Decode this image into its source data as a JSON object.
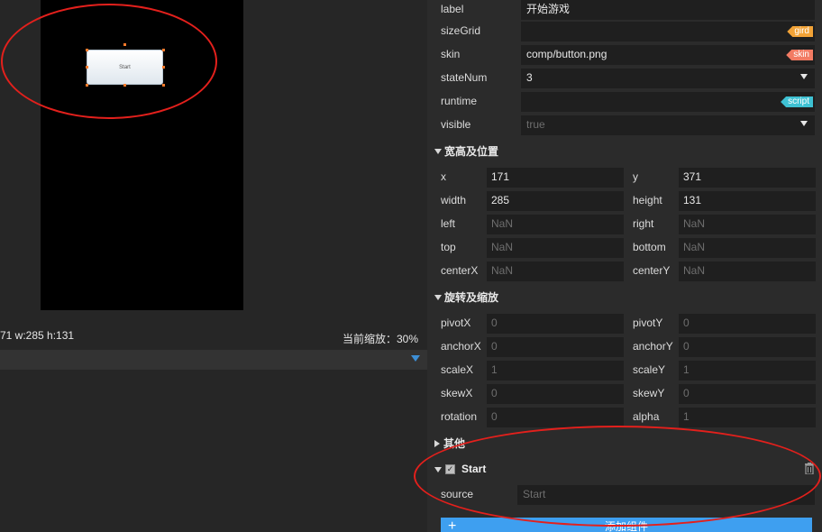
{
  "stage": {
    "selected_button_text": "Start"
  },
  "status": {
    "selection_info": "71  w:285 h:131",
    "zoom": "当前缩放：30%"
  },
  "properties": [
    {
      "label": "label",
      "value": "开始游戏",
      "muted": false,
      "tag": null,
      "dropdown": false
    },
    {
      "label": "sizeGrid",
      "value": "",
      "muted": false,
      "tag": "gird",
      "dropdown": false
    },
    {
      "label": "skin",
      "value": "comp/button.png",
      "muted": false,
      "tag": "skin",
      "dropdown": false
    },
    {
      "label": "stateNum",
      "value": "3",
      "muted": false,
      "tag": null,
      "dropdown": true
    },
    {
      "label": "runtime",
      "value": "",
      "muted": false,
      "tag": "script",
      "dropdown": false
    },
    {
      "label": "visible",
      "value": "true",
      "muted": true,
      "tag": null,
      "dropdown": true
    }
  ],
  "sections": {
    "size_position": "宽高及位置",
    "rotate_scale": "旋转及缩放",
    "other": "其他"
  },
  "size_position": [
    {
      "l_label": "x",
      "l_value": "171",
      "r_label": "y",
      "r_value": "371",
      "muted": false
    },
    {
      "l_label": "width",
      "l_value": "285",
      "r_label": "height",
      "r_value": "131",
      "muted": false
    },
    {
      "l_label": "left",
      "l_value": "NaN",
      "r_label": "right",
      "r_value": "NaN",
      "muted": true
    },
    {
      "l_label": "top",
      "l_value": "NaN",
      "r_label": "bottom",
      "r_value": "NaN",
      "muted": true
    },
    {
      "l_label": "centerX",
      "l_value": "NaN",
      "r_label": "centerY",
      "r_value": "NaN",
      "muted": true
    }
  ],
  "rotate_scale": [
    {
      "l_label": "pivotX",
      "l_value": "0",
      "r_label": "pivotY",
      "r_value": "0",
      "muted": true
    },
    {
      "l_label": "anchorX",
      "l_value": "0",
      "r_label": "anchorY",
      "r_value": "0",
      "muted": true
    },
    {
      "l_label": "scaleX",
      "l_value": "1",
      "r_label": "scaleY",
      "r_value": "1",
      "muted": true
    },
    {
      "l_label": "skewX",
      "l_value": "0",
      "r_label": "skewY",
      "r_value": "0",
      "muted": true
    },
    {
      "l_label": "rotation",
      "l_value": "0",
      "r_label": "alpha",
      "r_value": "1",
      "muted": true
    }
  ],
  "component": {
    "name": "Start",
    "checked": true,
    "source_label": "source",
    "source_placeholder": "Start"
  },
  "add_component_label": "添加组件",
  "colors": {
    "panel_bg": "#2b2b2b",
    "field_bg": "#1f1f1f",
    "accent_blue": "#3e9ff0",
    "annotation_red": "#e3201c"
  }
}
